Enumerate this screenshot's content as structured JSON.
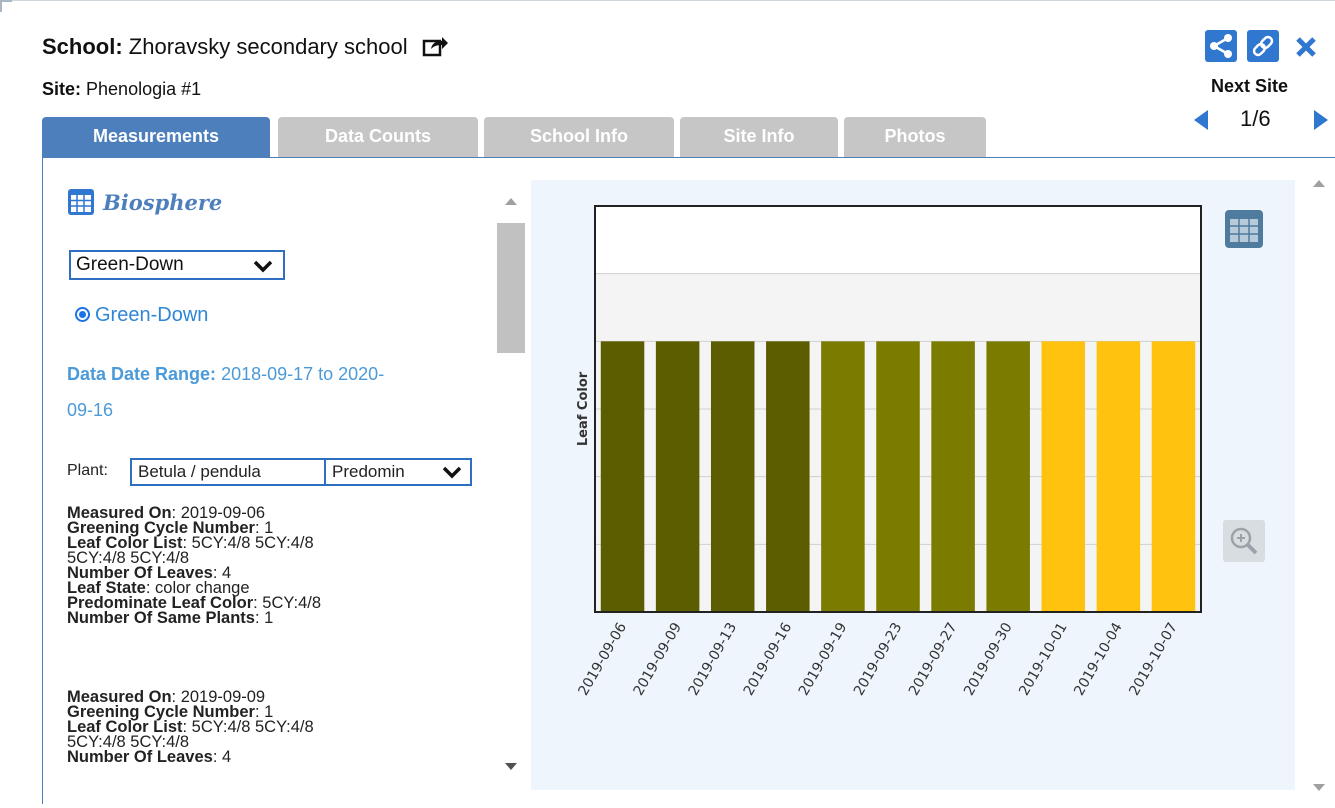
{
  "header": {
    "school_label": "School:",
    "school_name": "Zhoravsky secondary school",
    "site_label": "Site:",
    "site_name": "Phenologia #1",
    "next_site_label": "Next Site",
    "pager_text": "1/6"
  },
  "tabs": [
    {
      "label": "Measurements",
      "active": true
    },
    {
      "label": "Data Counts",
      "active": false
    },
    {
      "label": "School Info",
      "active": false
    },
    {
      "label": "Site Info",
      "active": false
    },
    {
      "label": "Photos",
      "active": false
    }
  ],
  "left_panel": {
    "section_title": "Biosphere",
    "protocol_select_value": "Green-Down",
    "radio_label": "Green-Down",
    "date_range_label": "Data Date Range:",
    "date_range_value_line1": "2018-09-17 to 2020-",
    "date_range_value_line2": "09-16",
    "plant_label": "Plant:",
    "plant_species_value": "Betula / pendula",
    "plant_color_value": "Predomin"
  },
  "records": [
    {
      "measured_on_label": "Measured On",
      "measured_on": ": 2019-09-06",
      "cycle_label": "Greening Cycle Number",
      "cycle": ": 1",
      "leaf_list_label": "Leaf Color List",
      "leaf_list_1": ": 5CY:4/8 5CY:4/8",
      "leaf_list_2": "5CY:4/8 5CY:4/8",
      "leaves_label": "Number Of Leaves",
      "leaves": ": 4",
      "state_label": "Leaf State",
      "state": ": color change",
      "predom_label": "Predominate Leaf Color",
      "predom": ": 5CY:4/8",
      "same_label": "Number Of Same Plants",
      "same": ": 1"
    },
    {
      "measured_on_label": "Measured On",
      "measured_on": ": 2019-09-09",
      "cycle_label": "Greening Cycle Number",
      "cycle": ": 1",
      "leaf_list_label": "Leaf Color List",
      "leaf_list_1": ": 5CY:4/8 5CY:4/8",
      "leaf_list_2": "5CY:4/8 5CY:4/8",
      "leaves_label": "Number Of Leaves",
      "leaves": ": 4"
    }
  ],
  "icons": {
    "share": "share-icon",
    "link": "link-icon",
    "close": "close-icon",
    "external": "external-link-icon",
    "table": "table-icon",
    "zoom": "zoom-in-icon"
  },
  "colors": {
    "accent": "#4d7fbd",
    "link_blue": "#2f77cf",
    "bar_dark_olive": "#5c5c00",
    "bar_olive": "#7b7b00",
    "bar_yellow": "#ffc20e"
  },
  "chart_data": {
    "type": "bar",
    "title": "",
    "xlabel": "",
    "ylabel": "Leaf Color",
    "categories": [
      "2019-09-06",
      "2019-09-09",
      "2019-09-13",
      "2019-09-16",
      "2019-09-19",
      "2019-09-23",
      "2019-09-27",
      "2019-09-30",
      "2019-10-01",
      "2019-10-04",
      "2019-10-07"
    ],
    "values": [
      1,
      1,
      1,
      1,
      1,
      1,
      1,
      1,
      1,
      1,
      1
    ],
    "bar_colors": [
      "#5c5c00",
      "#5c5c00",
      "#5c5c00",
      "#5c5c00",
      "#7b7b00",
      "#7b7b00",
      "#7b7b00",
      "#7b7b00",
      "#ffc20e",
      "#ffc20e",
      "#ffc20e"
    ],
    "ylim": [
      0,
      1.5
    ],
    "grid": true,
    "legend": "none"
  }
}
